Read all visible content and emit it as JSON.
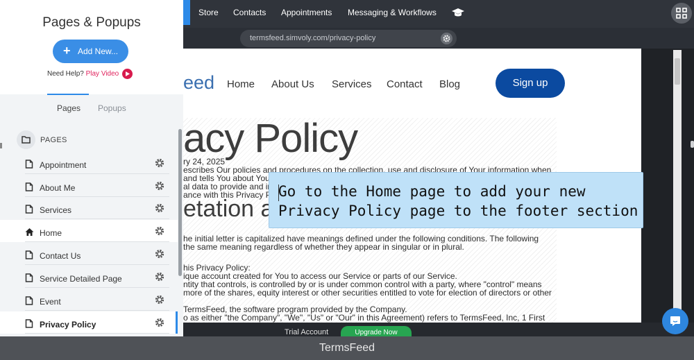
{
  "topnav": {
    "items": [
      "Store",
      "Contacts",
      "Appointments",
      "Messaging & Workflows"
    ]
  },
  "url_bar": {
    "url": "termsfeed.simvoly.com/privacy-policy"
  },
  "site": {
    "logo_partial": "eed",
    "nav": [
      "Home",
      "About Us",
      "Services",
      "Contact",
      "Blog"
    ],
    "signup_label": "Sign up",
    "heading": "acy Policy",
    "date_line": "ry 24, 2025",
    "intro_lines": [
      "escribes Our policies and procedures on the collection, use and disclosure of Your information when",
      "and tells You about Your",
      "al data to provide and im",
      "ance with this Privacy P"
    ],
    "subheading": "etation ar",
    "body_lines": [
      "he initial letter is capitalized have meanings defined under the following conditions. The following",
      " the same meaning regardless of whether they appear in singular or in plural.",
      "",
      "his Privacy Policy:",
      "ique account created for You to access our Service or parts of our Service.",
      "ntity that controls, is controlled by or is under common control with a party, where \"control\" means",
      " more of the shares, equity interest or other securities entitled to vote for election of directors or other",
      "",
      " TermsFeed, the software program provided by the Company.",
      "o as either \"the Company\", \"We\", \"Us\" or \"Our\" in this Agreement) refers to TermsFeed, Inc, 1 First"
    ]
  },
  "callout": {
    "line1": "Go to the Home page to add your new",
    "line2": "Privacy Policy page to the footer section"
  },
  "editor_bottom": {
    "trial_label": "Trial Account",
    "upgrade_label": "Upgrade Now"
  },
  "panel": {
    "title": "Pages & Popups",
    "add_button": "Add New...",
    "help_prefix": "Need Help?",
    "help_link": "Play Video",
    "tabs": [
      "Pages",
      "Popups"
    ],
    "section_label": "PAGES",
    "pages": [
      {
        "name": "Appointment",
        "icon": "page-icon"
      },
      {
        "name": "About Me",
        "icon": "page-icon"
      },
      {
        "name": "Services",
        "icon": "page-icon"
      },
      {
        "name": "Home",
        "icon": "home-icon"
      },
      {
        "name": "Contact Us",
        "icon": "page-icon"
      },
      {
        "name": "Service Detailed Page",
        "icon": "page-icon"
      },
      {
        "name": "Event",
        "icon": "page-icon"
      },
      {
        "name": "Privacy Policy",
        "icon": "page-icon",
        "active": true
      }
    ]
  },
  "caption": "TermsFeed",
  "colors": {
    "accent": "#2d8ae8",
    "signup": "#0b4aa0",
    "upgrade": "#27a551",
    "callout": "#bfe1f8",
    "play": "#d81b4d"
  }
}
